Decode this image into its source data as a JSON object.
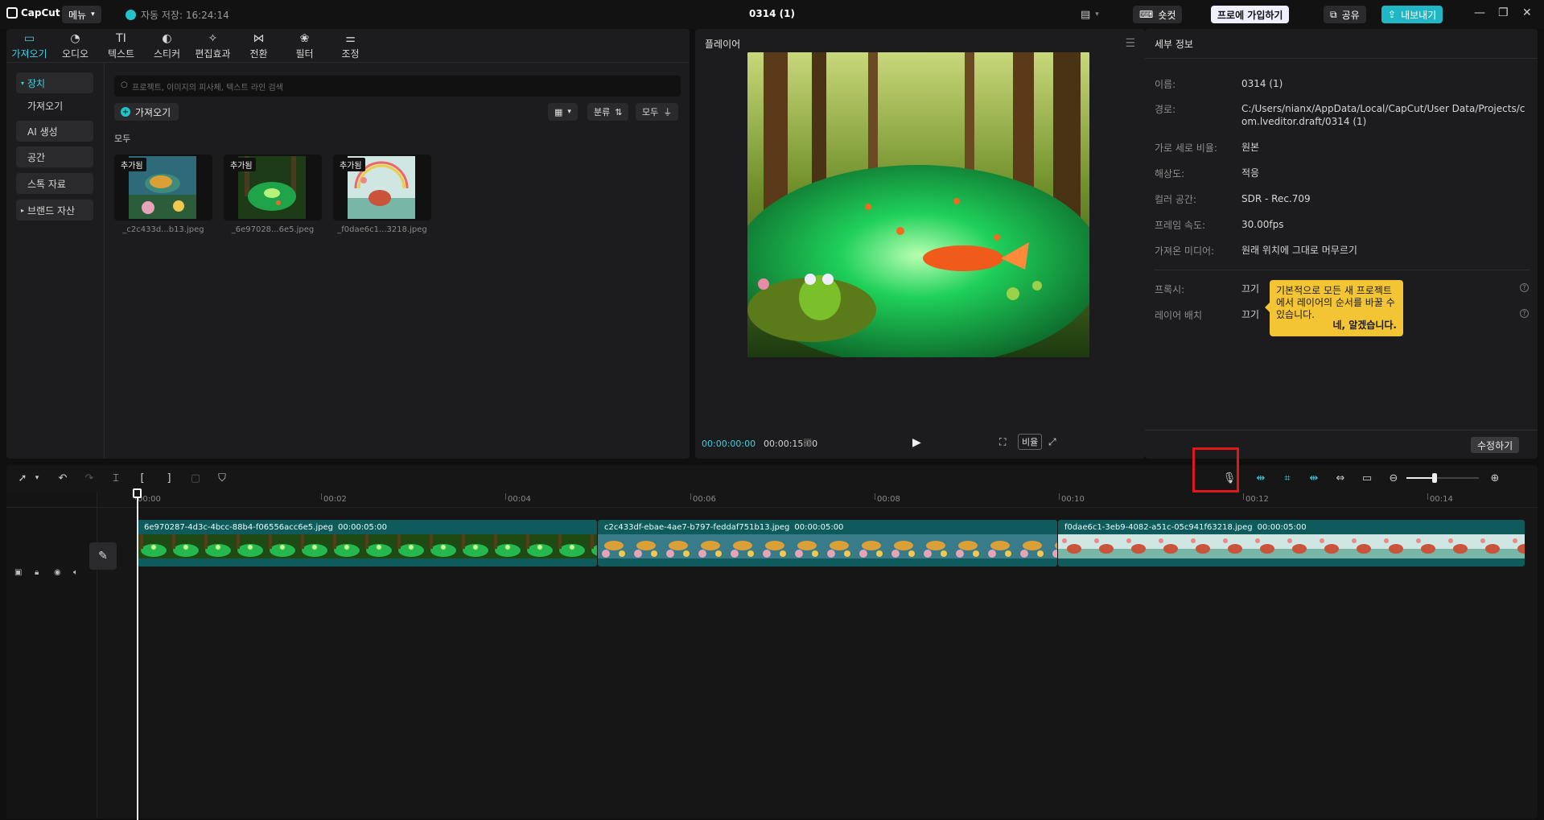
{
  "titlebar": {
    "app_name": "CapCut",
    "menu_label": "메뉴",
    "autosave": "자동 저장: 16:24:14",
    "project_title": "0314 (1)",
    "shortcut_label": "숏컷",
    "pro_label": "프로에 가입하기",
    "share_label": "공유",
    "export_label": "내보내기"
  },
  "media": {
    "tabs": [
      {
        "label": "가져오기",
        "icon": "▭"
      },
      {
        "label": "오디오",
        "icon": "◔"
      },
      {
        "label": "텍스트",
        "icon": "TI"
      },
      {
        "label": "스티커",
        "icon": "◐"
      },
      {
        "label": "편집효과",
        "icon": "✧"
      },
      {
        "label": "전환",
        "icon": "⋈"
      },
      {
        "label": "필터",
        "icon": "❀"
      },
      {
        "label": "조정",
        "icon": "⚌"
      }
    ],
    "sidebar": [
      {
        "label": "장치"
      },
      {
        "label": "가져오기"
      },
      {
        "label": "AI 생성"
      },
      {
        "label": "공간"
      },
      {
        "label": "스톡 자료"
      },
      {
        "label": "브랜드 자산"
      }
    ],
    "search_placeholder": "프로젝트, 이미지의 피사체, 텍스트 라인 검색",
    "import_button": "가져오기",
    "sort_label": "분류",
    "filter_label": "모두",
    "section_label": "모두",
    "thumbs": [
      {
        "badge": "추가됨",
        "name": "_c2c433d...b13.jpeg"
      },
      {
        "badge": "추가됨",
        "name": "_6e97028...6e5.jpeg"
      },
      {
        "badge": "추가됨",
        "name": "_f0dae6c1...3218.jpeg"
      }
    ]
  },
  "player": {
    "title": "플레이어",
    "current_time": "00:00:00:00",
    "total_time": "00:00:15:00",
    "ratio_label": "비율"
  },
  "details": {
    "title": "세부 정보",
    "rows": [
      {
        "label": "이름:",
        "value": "0314 (1)"
      },
      {
        "label": "경로:",
        "value": "C:/Users/nianx/AppData/Local/CapCut/User Data/Projects/com.lveditor.draft/0314 (1)"
      },
      {
        "label": "가로 세로 비율:",
        "value": "원본"
      },
      {
        "label": "해상도:",
        "value": "적응"
      },
      {
        "label": "컬러 공간:",
        "value": "SDR - Rec.709"
      },
      {
        "label": "프레임 속도:",
        "value": "30.00fps"
      },
      {
        "label": "가져온 미디어:",
        "value": "원래 위치에 그대로 머무르기"
      }
    ],
    "proxy_label": "프록시:",
    "proxy_value": "끄기",
    "layer_label": "레이어 배치",
    "layer_value": "끄기",
    "tooltip_text": "기본적으로 모든 새 프로젝트에서 레이어의 순서를 바꿀 수 있습니다.",
    "tooltip_ok": "네, 알겠습니다.",
    "edit_button": "수정하기"
  },
  "timeline": {
    "ticks": [
      "00:00",
      "00:02",
      "00:04",
      "00:06",
      "00:08",
      "00:10",
      "00:12",
      "00:14"
    ],
    "clips": [
      {
        "name": "6e970287-4d3c-4bcc-88b4-f06556acc6e5.jpeg",
        "duration": "00:00:05:00"
      },
      {
        "name": "c2c433df-ebae-4ae7-b797-feddaf751b13.jpeg",
        "duration": "00:00:05:00"
      },
      {
        "name": "f0dae6c1-3eb9-4082-a51c-05c941f63218.jpeg",
        "duration": "00:00:05:00"
      }
    ]
  },
  "colors": {
    "accent": "#3fd0e0",
    "clip_bg": "#0f5a5a",
    "tooltip_bg": "#f3c433",
    "highlight": "#e01818"
  }
}
